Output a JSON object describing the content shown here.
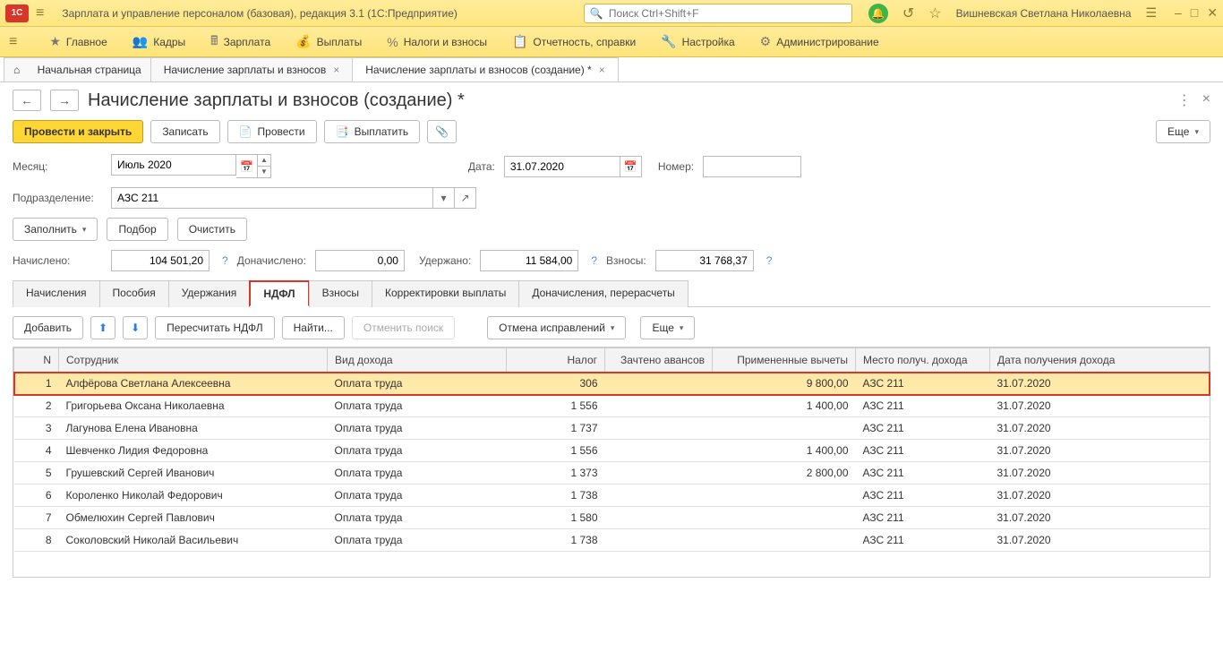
{
  "title": "Зарплата и управление персоналом (базовая), редакция 3.1  (1С:Предприятие)",
  "search_placeholder": "Поиск Ctrl+Shift+F",
  "user": "Вишневская Светлана Николаевна",
  "menu": {
    "main": "Главное",
    "hr": "Кадры",
    "salary": "Зарплата",
    "payments": "Выплаты",
    "taxes": "Налоги и взносы",
    "reports": "Отчетность, справки",
    "setup": "Настройка",
    "admin": "Администрирование"
  },
  "open_tabs": {
    "start": "Начальная страница",
    "t1": "Начисление зарплаты и взносов",
    "t2": "Начисление зарплаты и взносов (создание) *"
  },
  "doc_title": "Начисление зарплаты и взносов (создание) *",
  "buttons": {
    "post_close": "Провести и закрыть",
    "write": "Записать",
    "post": "Провести",
    "pay": "Выплатить",
    "more": "Еще",
    "fill": "Заполнить",
    "select": "Подбор",
    "clear": "Очистить",
    "add": "Добавить",
    "recalc": "Пересчитать НДФЛ",
    "find": "Найти...",
    "cancel_search": "Отменить поиск",
    "cancel_fix": "Отмена исправлений"
  },
  "labels": {
    "month": "Месяц:",
    "date": "Дата:",
    "number": "Номер:",
    "dept": "Подразделение:",
    "accrued": "Начислено:",
    "add_accrued": "Доначислено:",
    "withheld": "Удержано:",
    "contrib": "Взносы:"
  },
  "values": {
    "month": "Июль 2020",
    "date": "31.07.2020",
    "number": "",
    "dept": "АЗС 211",
    "accrued": "104 501,20",
    "add_accrued": "0,00",
    "withheld": "11 584,00",
    "contrib": "31 768,37"
  },
  "tabs2": {
    "accruals": "Начисления",
    "benefits": "Пособия",
    "deductions": "Удержания",
    "ndfl": "НДФЛ",
    "contrib": "Взносы",
    "pay_corr": "Корректировки выплаты",
    "recalcs": "Доначисления, перерасчеты"
  },
  "columns": {
    "n": "N",
    "emp": "Сотрудник",
    "income_type": "Вид дохода",
    "tax": "Налог",
    "advance": "Зачтено авансов",
    "deducts": "Примененные вычеты",
    "place": "Место получ. дохода",
    "date": "Дата получения дохода"
  },
  "rows": [
    {
      "n": "1",
      "emp": "Алфёрова Светлана Алексеевна",
      "type": "Оплата труда",
      "tax": "306",
      "adv": "",
      "ded": "9 800,00",
      "place": "АЗС 211",
      "date": "31.07.2020"
    },
    {
      "n": "2",
      "emp": "Григорьева Оксана Николаевна",
      "type": "Оплата труда",
      "tax": "1 556",
      "adv": "",
      "ded": "1 400,00",
      "place": "АЗС 211",
      "date": "31.07.2020"
    },
    {
      "n": "3",
      "emp": "Лагунова Елена Ивановна",
      "type": "Оплата труда",
      "tax": "1 737",
      "adv": "",
      "ded": "",
      "place": "АЗС 211",
      "date": "31.07.2020"
    },
    {
      "n": "4",
      "emp": "Шевченко Лидия Федоровна",
      "type": "Оплата труда",
      "tax": "1 556",
      "adv": "",
      "ded": "1 400,00",
      "place": "АЗС 211",
      "date": "31.07.2020"
    },
    {
      "n": "5",
      "emp": "Грушевский Сергей Иванович",
      "type": "Оплата труда",
      "tax": "1 373",
      "adv": "",
      "ded": "2 800,00",
      "place": "АЗС 211",
      "date": "31.07.2020"
    },
    {
      "n": "6",
      "emp": "Короленко Николай Федорович",
      "type": "Оплата труда",
      "tax": "1 738",
      "adv": "",
      "ded": "",
      "place": "АЗС 211",
      "date": "31.07.2020"
    },
    {
      "n": "7",
      "emp": "Обмелюхин Сергей Павлович",
      "type": "Оплата труда",
      "tax": "1 580",
      "adv": "",
      "ded": "",
      "place": "АЗС 211",
      "date": "31.07.2020"
    },
    {
      "n": "8",
      "emp": "Соколовский Николай Васильевич",
      "type": "Оплата труда",
      "tax": "1 738",
      "adv": "",
      "ded": "",
      "place": "АЗС 211",
      "date": "31.07.2020"
    }
  ]
}
